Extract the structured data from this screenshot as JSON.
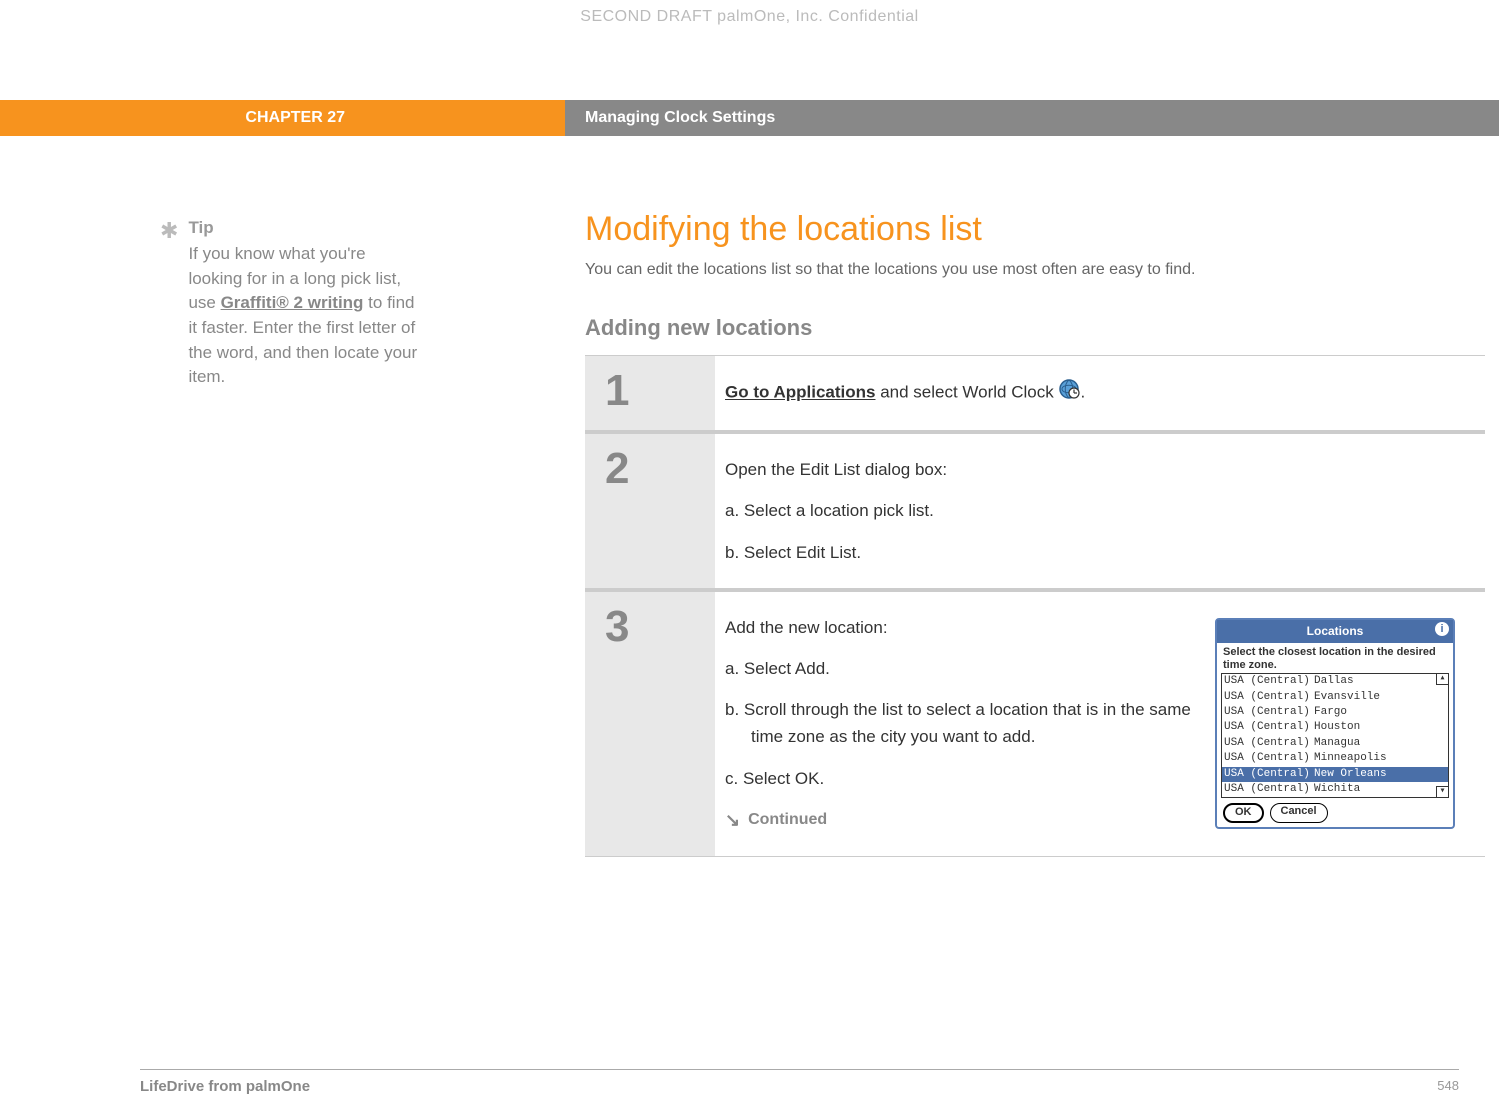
{
  "watermark": "SECOND DRAFT palmOne, Inc.  Confidential",
  "header": {
    "chapter": "CHAPTER 27",
    "title": "Managing Clock Settings"
  },
  "sidebar": {
    "tip_label": "Tip",
    "tip_pre": "If you know what you're looking for in a long pick list, use ",
    "tip_link": "Graffiti® 2 writing",
    "tip_post": " to find it faster. Enter the first letter of the word, and then locate your item."
  },
  "main": {
    "h1": "Modifying the locations list",
    "intro": "You can edit the locations list so that the locations you use most often are easy to find.",
    "h2": "Adding new locations"
  },
  "steps": {
    "s1": {
      "num": "1",
      "link": "Go to Applications",
      "rest": " and select World Clock ",
      "period": "."
    },
    "s2": {
      "num": "2",
      "lead": "Open the Edit List dialog box:",
      "a": "a.  Select a location pick list.",
      "b": "b.  Select Edit List."
    },
    "s3": {
      "num": "3",
      "lead": "Add the new location:",
      "a": "a.  Select Add.",
      "b": "b.  Scroll through the list to select a location that is in the same time zone as the city you want to add.",
      "c": "c.  Select OK.",
      "continued": "Continued"
    }
  },
  "screenshot": {
    "title": "Locations",
    "instruction": "Select the closest location in the desired time zone.",
    "zone": "USA (Central)",
    "cities": [
      "Dallas",
      "Evansville",
      "Fargo",
      "Houston",
      "Managua",
      "Minneapolis",
      "New Orleans",
      "Wichita"
    ],
    "selected_index": 6,
    "ok": "OK",
    "cancel": "Cancel"
  },
  "footer": {
    "left": "LifeDrive from palmOne",
    "right": "548"
  }
}
